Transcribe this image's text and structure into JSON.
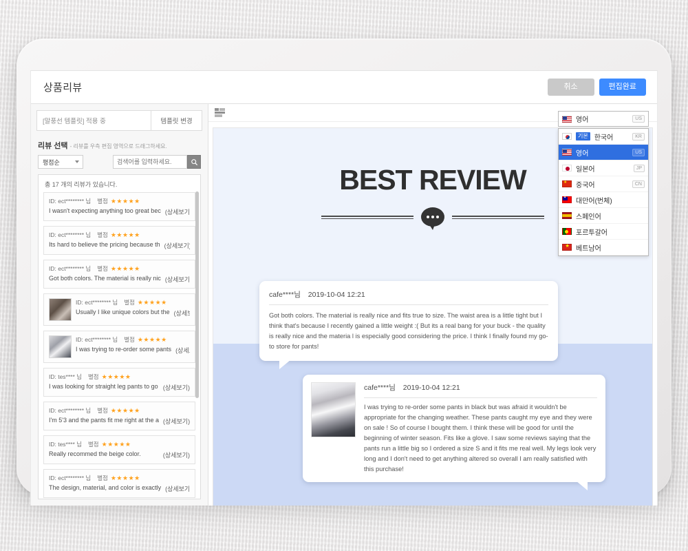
{
  "header": {
    "title": "상품리뷰",
    "cancel_label": "취소",
    "done_label": "편집완료"
  },
  "left_panel": {
    "template_name": "[말풍선 템플릿] 적용 중",
    "template_change_label": "템플릿 변경",
    "section_title": "리뷰 선택",
    "section_hint": "- 리뷰를 우측 편집 영역으로 드래그하세요.",
    "sort_value": "평점순",
    "search_placeholder": "검색어를 입력하세요.",
    "search_icon": "search-icon",
    "count_text": "총 17 개의 리뷰가 있습니다.",
    "rating_label": "별점",
    "stars": "★★★★★",
    "detail_label": "(상세보기)",
    "reviews": [
      {
        "id": "ID: ect******** 님",
        "text": "I wasn't expecting anything too great bec",
        "has_thumb": false
      },
      {
        "id": "ID: ect******** 님",
        "text": "Its hard to believe the pricing because th",
        "has_thumb": false
      },
      {
        "id": "ID: ect******** 님",
        "text": "Got both colors. The material is really nic",
        "has_thumb": false
      },
      {
        "id": "ID: ect******** 님",
        "text": "Usually I like unique colors but the",
        "has_thumb": true,
        "thumb_kind": "t1"
      },
      {
        "id": "ID: ect******** 님",
        "text": "I was trying to re-order some pants",
        "has_thumb": true,
        "thumb_kind": "t2"
      },
      {
        "id": "ID: tes**** 님",
        "text": "I was looking for straight leg pants to go",
        "has_thumb": false
      },
      {
        "id": "ID: ect******** 님",
        "text": "I'm 5'3 and the pants fit me right at the a",
        "has_thumb": false
      },
      {
        "id": "ID: tes**** 님",
        "text": "Really recommed the beige color.",
        "has_thumb": false
      },
      {
        "id": "ID: ect******** 님",
        "text": "The design, material, and color is exactly",
        "has_thumb": false
      }
    ]
  },
  "canvas": {
    "toolbar_icon": "layout-icon",
    "banner_title": "BEST REVIEW",
    "banner_icon": "speech-bubble-dots-icon",
    "speech_cards": [
      {
        "author": "cafe****님",
        "date": "2019-10-04 12:21",
        "text": "Got both colors. The material is really nice and fits true to size. The waist area is a little tight but I think that's because I recently gained a little weight :( But its a real bang for your buck - the quality is really nice and the materia l is especially good considering the price. I think I finally found my go-to store for pants!",
        "has_photo": false
      },
      {
        "author": "cafe****님",
        "date": "2019-10-04 12:21",
        "text": "I was trying to re-order some pants in black but was afraid it wouldn't be appropriate for the changing weather. These pants caught my eye and they were on sale ! So of course I bought them. I think these will be good for until the beginning of winter season. Fits like a glove. I saw some reviews saying that the pants run a little big so I ordered a size S and it fits me real well. My legs look very long and I don't need to get anything altered so overall I am really satisfied with this purchase!",
        "has_photo": true
      }
    ]
  },
  "language_widget": {
    "selected": {
      "label": "영어",
      "code": "US",
      "flag": "flag-us"
    },
    "options": [
      {
        "label": "한국어",
        "code": "KR",
        "flag": "flag-kr",
        "basic_tag": "기본",
        "selected": false
      },
      {
        "label": "영어",
        "code": "US",
        "flag": "flag-us",
        "basic_tag": "",
        "selected": true
      },
      {
        "label": "일본어",
        "code": "JP",
        "flag": "flag-jp",
        "basic_tag": "",
        "selected": false
      },
      {
        "label": "중국어",
        "code": "CN",
        "flag": "flag-cn",
        "basic_tag": "",
        "selected": false
      },
      {
        "label": "대만어(번체)",
        "code": "",
        "flag": "flag-tw",
        "basic_tag": "",
        "selected": false
      },
      {
        "label": "스페인어",
        "code": "",
        "flag": "flag-es",
        "basic_tag": "",
        "selected": false
      },
      {
        "label": "포르투갈어",
        "code": "",
        "flag": "flag-pt",
        "basic_tag": "",
        "selected": false
      },
      {
        "label": "베트남어",
        "code": "",
        "flag": "flag-vn",
        "basic_tag": "",
        "selected": false
      }
    ]
  },
  "colors": {
    "accent_blue": "#3d8bff",
    "select_blue": "#2f6fe0",
    "star_orange": "#ffa21f",
    "canvas_top": "#eef3fc",
    "canvas_bottom": "#ccd9f5"
  }
}
